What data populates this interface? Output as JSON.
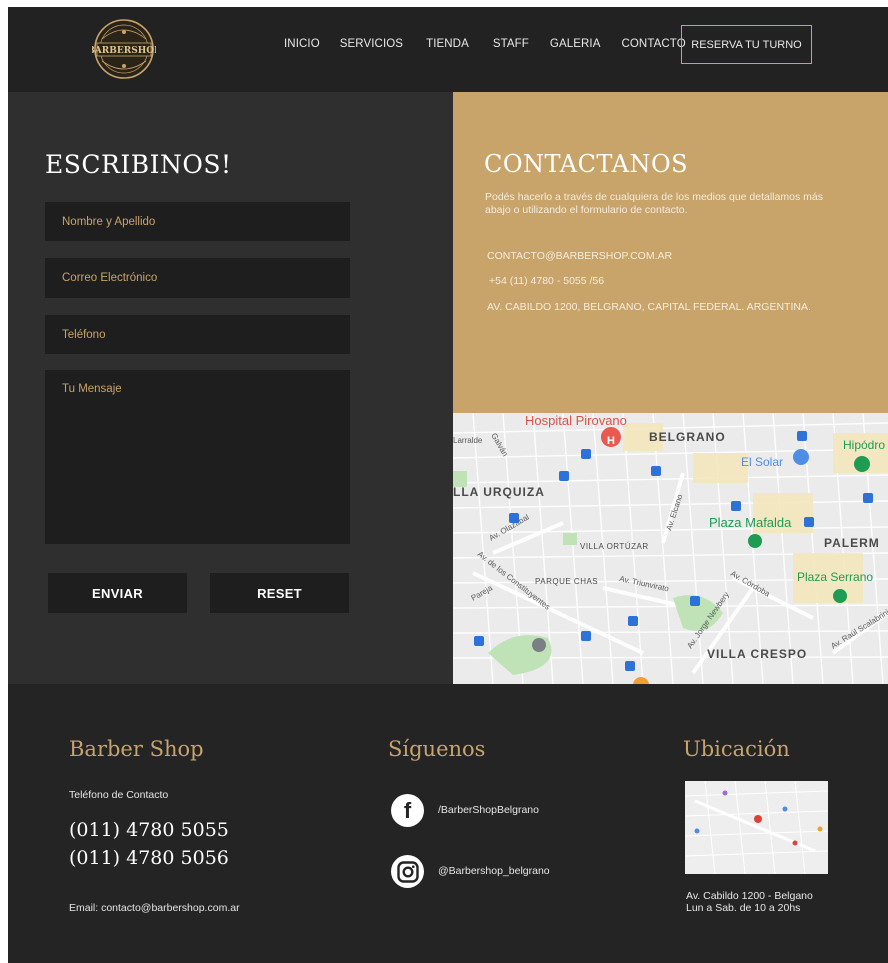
{
  "header": {
    "logo_text": "BARBERSHOP",
    "nav": [
      "INICIO",
      "SERVICIOS",
      "TIENDA",
      "STAFF",
      "GALERIA",
      "CONTACTO"
    ],
    "reserve_label": "RESERVA TU TURNO"
  },
  "form": {
    "title": "ESCRIBINOS!",
    "name_placeholder": "Nombre y Apellido",
    "email_placeholder": "Correo Electrónico",
    "phone_placeholder": "Teléfono",
    "message_placeholder": "Tu Mensaje",
    "send_label": "ENVIAR",
    "reset_label": "RESET"
  },
  "contact": {
    "title": "CONTACTANOS",
    "description": "Podés hacerlo a través de cualquiera de los medios que detallamos más abajo o utilizando el formulario de contacto.",
    "email": "CONTACTO@BARBERSHOP.COM.AR",
    "phone": "+54 (11) 4780 - 5055 /56",
    "address": "AV. CABILDO 1200, BELGRANO, CAPITAL FEDERAL. ARGENTINA."
  },
  "map": {
    "labels": {
      "hospital": "Hospital Pirovano",
      "belgrano": "BELGRANO",
      "hipodromo": "Hipódro",
      "el_solar": "El Solar",
      "urquiza": "LLA URQUIZA",
      "plaza_mafalda": "Plaza Mafalda",
      "palermo": "PALERM",
      "villa_ortuzar": "VILLA ORTÚZAR",
      "parque_chas": "PARQUE CHAS",
      "plaza_serrano": "Plaza Serrano",
      "villa_crespo": "VILLA CRESPO",
      "galvan": "Galván",
      "larralde": "Larralde",
      "elcano": "Av. Elcano",
      "olazabal": "Av. Olazábal",
      "constituyentes": "Av. de los Constituyentes",
      "pareja": "Pareja",
      "triunvirato": "Av. Triunvirato",
      "cordoba": "Av. Córdoba",
      "jorge_newbery": "Av. Jorge Newbery",
      "raul_scalabrini": "Av. Raúl Scalabrini"
    }
  },
  "footer": {
    "brand_title": "Barber Shop",
    "contact_label": "Teléfono de Contacto",
    "phone1": "(011) 4780 5055",
    "phone2": "(011) 4780 5056",
    "email": "Email: contacto@barbershop.com.ar",
    "social_title": "Síguenos",
    "facebook": "/BarberShopBelgrano",
    "instagram": "@Barbershop_belgrano",
    "location_title": "Ubicación",
    "address": "Av. Cabildo 1200 - Belgano",
    "hours": "Lun a Sab. de 10 a 20hs"
  },
  "colors": {
    "accent": "#c8a46b",
    "dark": "#222222",
    "panel": "#2f2f2f",
    "field": "#1e1e1e"
  }
}
